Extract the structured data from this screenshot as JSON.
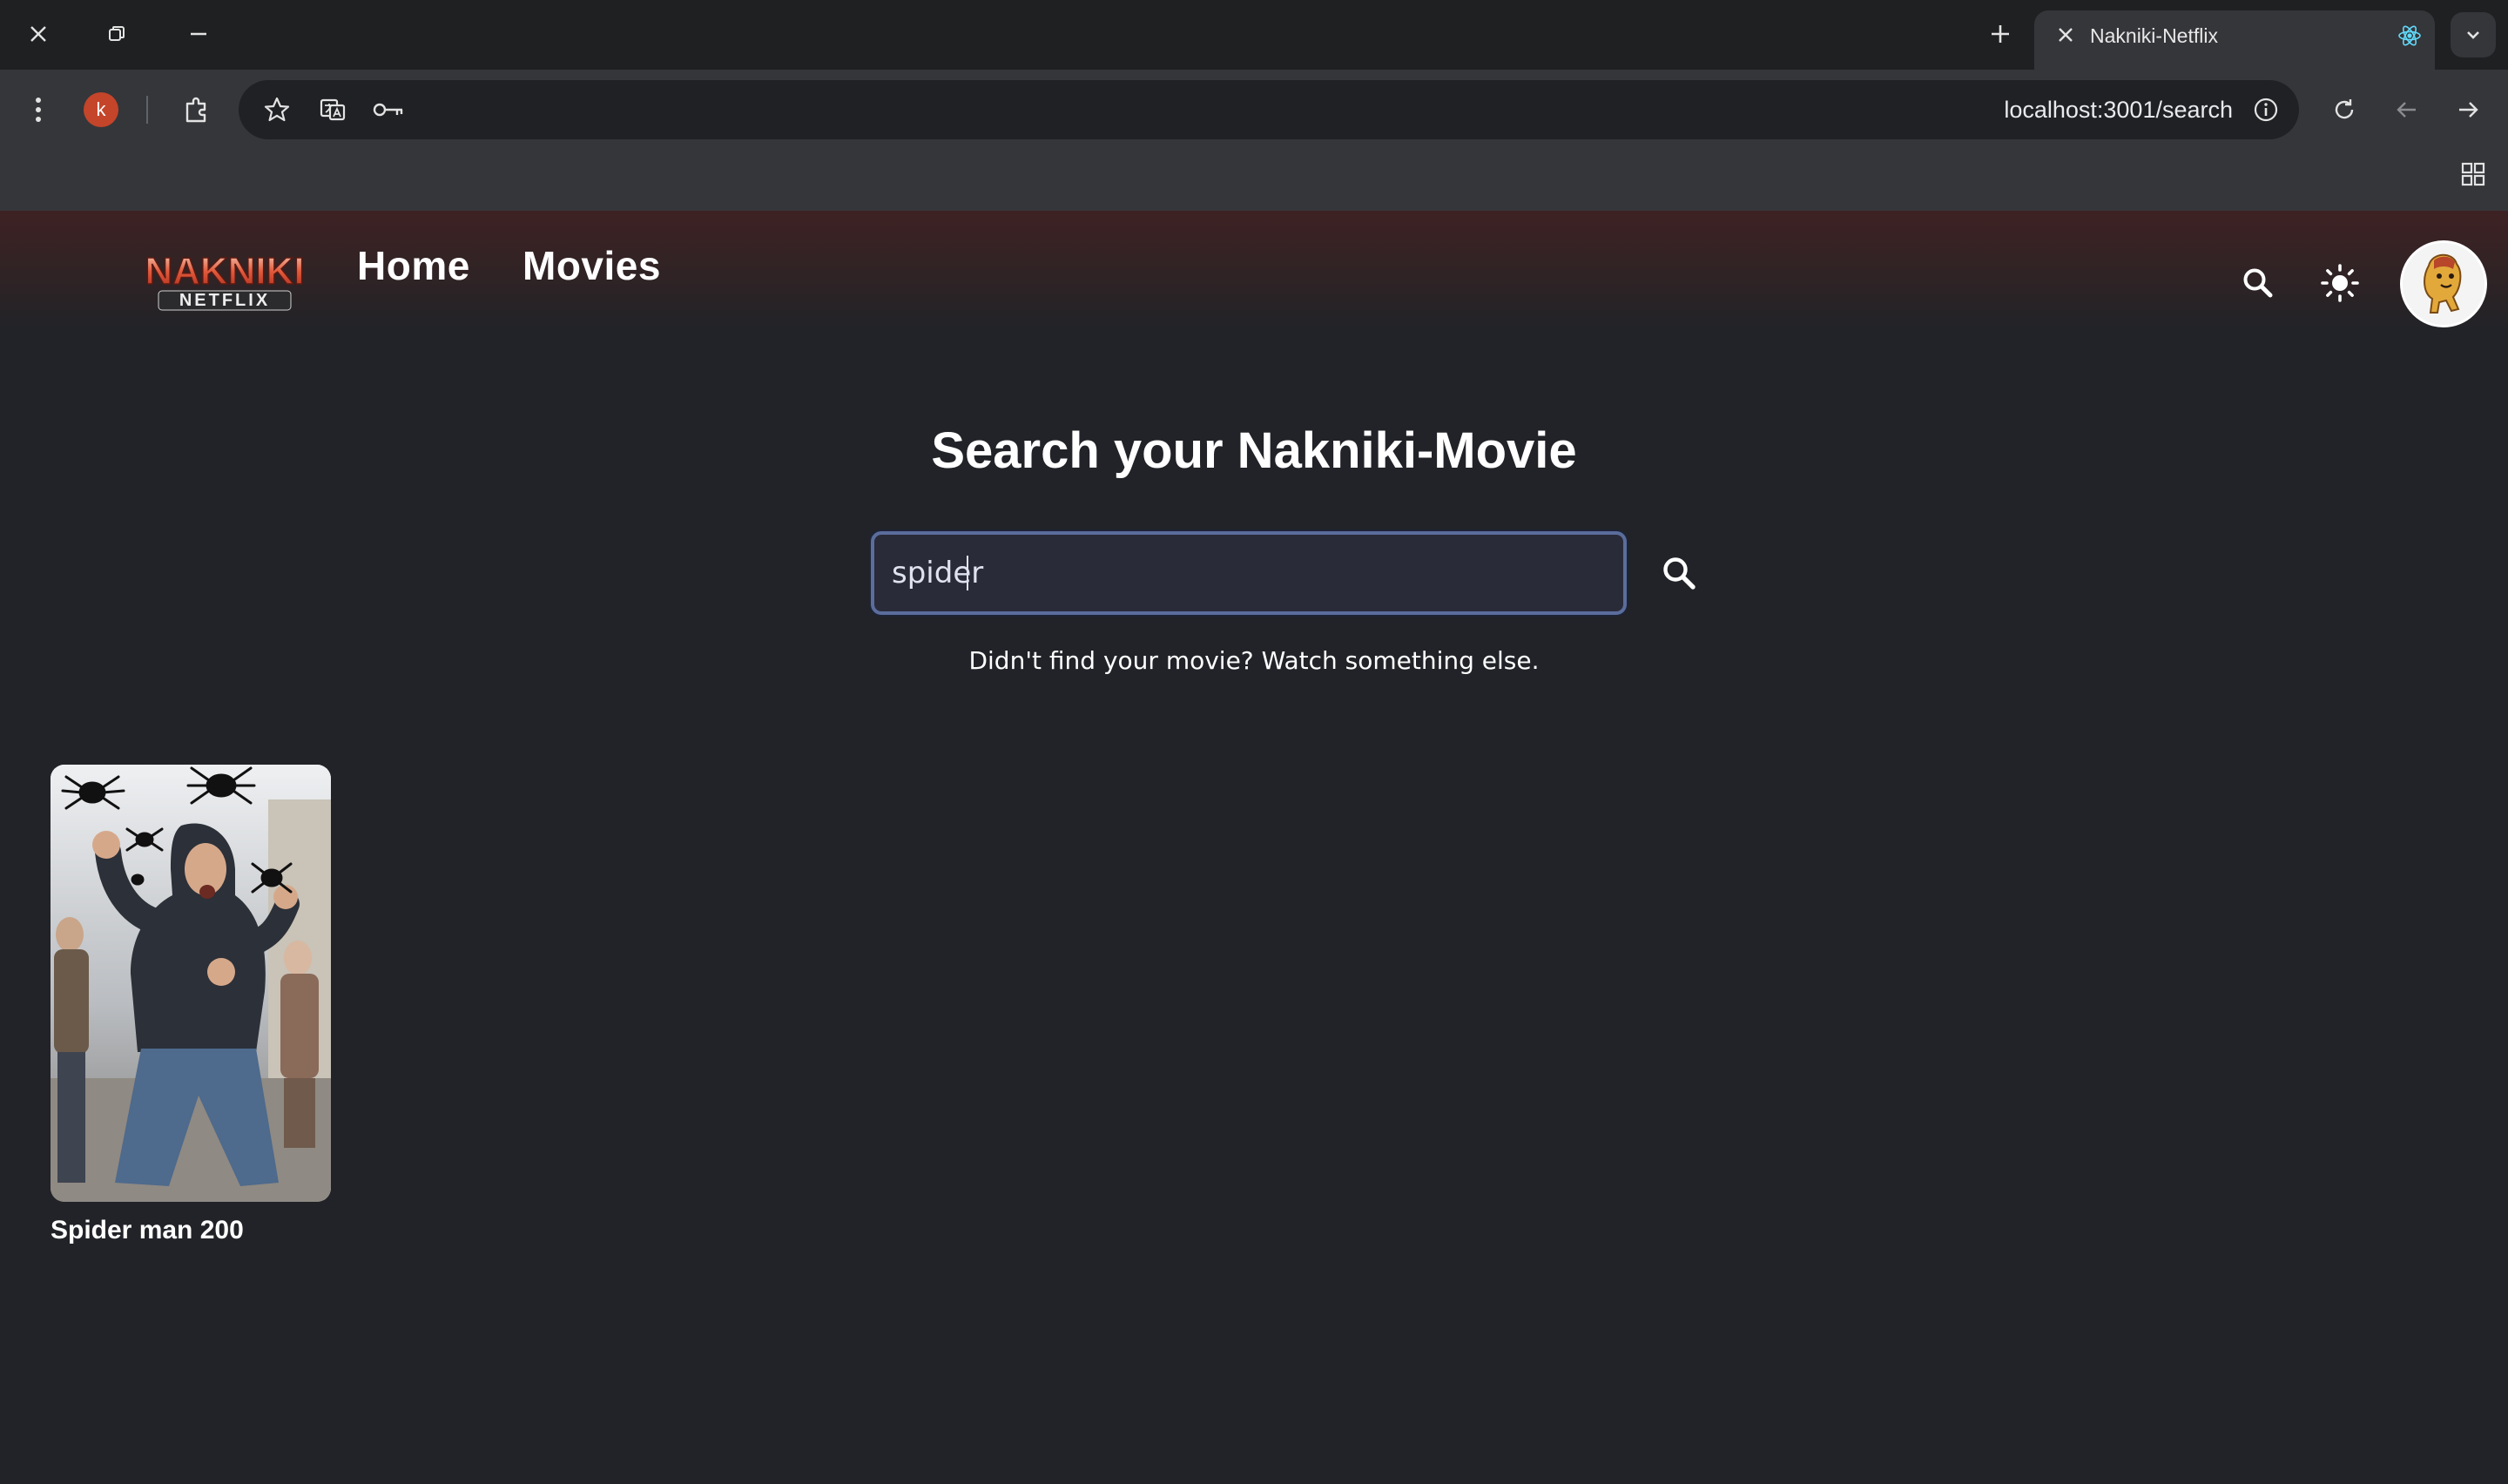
{
  "browser": {
    "tab_title": "Nakniki-Netflix",
    "profile_initial": "k",
    "url": "localhost:3001/search"
  },
  "header": {
    "logo_text_main": "NAKNIKI",
    "logo_text_sub": "NETFLIX",
    "nav": [
      {
        "label": "Home"
      },
      {
        "label": "Movies"
      }
    ]
  },
  "search": {
    "title": "Search your Nakniki-Movie",
    "value": "spider",
    "hint": "Didn't find your movie? Watch something else."
  },
  "results": [
    {
      "title": "Spider man 200"
    }
  ],
  "colors": {
    "background": "#212328",
    "header_top": "#3e2223",
    "input_border": "#5b6d9c",
    "accent_red": "#c4452a"
  }
}
